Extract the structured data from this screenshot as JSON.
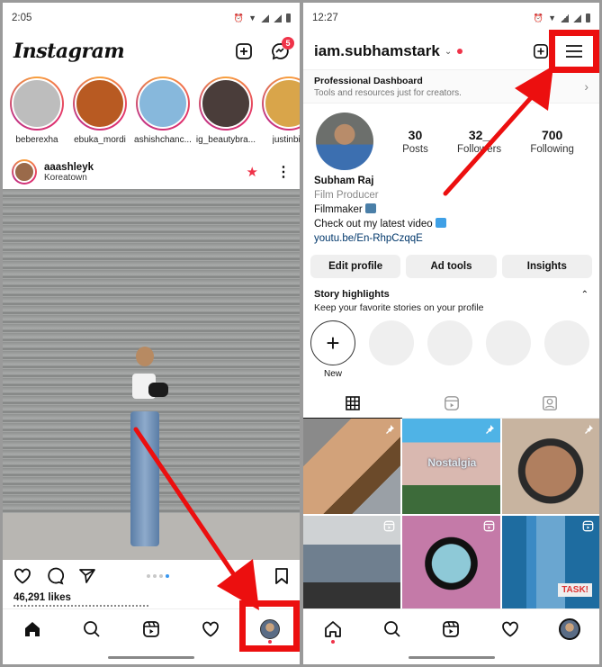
{
  "left": {
    "status": {
      "time": "2:05",
      "indicators": [
        "alarm-icon",
        "vibrate-icon",
        "volte-icon",
        "wifi-icon",
        "lte-icon",
        "signal-icon",
        "signal-icon",
        "battery-icon"
      ]
    },
    "header": {
      "logo": "Instagram",
      "new_post_icon": "plus-square-icon",
      "messenger_icon": "messenger-icon",
      "messenger_badge": "5"
    },
    "stories": [
      {
        "name": "beberexha",
        "color": "#bdbdbd"
      },
      {
        "name": "ebuka_mordi",
        "color": "#b85a22"
      },
      {
        "name": "ashishchanc...",
        "color": "#87b8dc"
      },
      {
        "name": "ig_beautybra...",
        "color": "#4a3d3a"
      },
      {
        "name": "justinbie",
        "color": "#d9a54a"
      }
    ],
    "post": {
      "username": "aaashleyk",
      "location": "Koreatown",
      "likes": "46,291 likes",
      "caption_preview": "aaashleyk ...",
      "carousel_count": 4,
      "carousel_active_index": 3
    },
    "bottom_nav": [
      "home-icon",
      "search-icon",
      "reels-icon",
      "heart-icon",
      "profile-avatar"
    ]
  },
  "right": {
    "status": {
      "time": "12:27"
    },
    "header": {
      "username": "iam.subhamstark",
      "new_post_icon": "plus-square-icon",
      "menu_icon": "hamburger-menu-icon"
    },
    "dashboard": {
      "title": "Professional Dashboard",
      "subtitle": "Tools and resources just for creators."
    },
    "stats": [
      {
        "value": "30",
        "label": "Posts"
      },
      {
        "value": "32_",
        "label": "Followers"
      },
      {
        "value": "700",
        "label": "Following"
      }
    ],
    "bio": {
      "name": "Subham Raj",
      "category": "Film Producer",
      "line1": "Filmmaker",
      "line2": "Check out my latest video",
      "link": "youtu.be/En-RhpCzqqE"
    },
    "buttons": [
      "Edit profile",
      "Ad tools",
      "Insights"
    ],
    "highlights": {
      "title": "Story highlights",
      "subtitle": "Keep your favorite stories on your profile",
      "new_label": "New",
      "placeholders": 4
    },
    "tabs": [
      "grid-icon",
      "reels-icon",
      "tagged-icon"
    ],
    "grid": [
      {
        "type": "pinned",
        "text": ""
      },
      {
        "type": "pinned",
        "text": "Nostalgia"
      },
      {
        "type": "pinned",
        "text": ""
      },
      {
        "type": "reel",
        "text": ""
      },
      {
        "type": "reel",
        "text": ""
      },
      {
        "type": "reel",
        "text": "TASK!"
      }
    ]
  },
  "annotations": {
    "highlight_color": "#ec0f0f"
  }
}
